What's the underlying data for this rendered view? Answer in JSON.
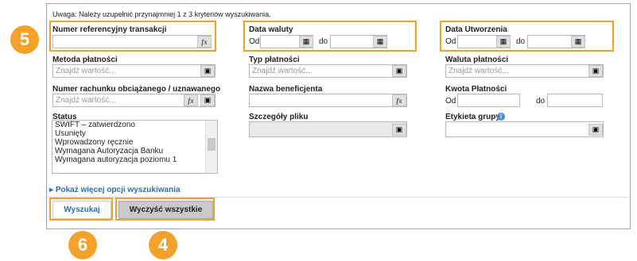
{
  "note": "Uwaga: Należy uzupełnić przynajmniej 1 z 3 kryteriów wyszukiwania.",
  "fields": {
    "numer_ref": {
      "label": "Numer referencyjny transakcji",
      "value": "",
      "fx": "fx"
    },
    "data_waluty": {
      "label": "Data waluty",
      "od": "Od",
      "do": "do"
    },
    "data_utworzenia": {
      "label": "Data Utworzenia",
      "od": "Od",
      "do": "do"
    },
    "metoda": {
      "label": "Metoda płatności",
      "placeholder": "Znajdź wartość..."
    },
    "typ": {
      "label": "Typ płatności",
      "placeholder": "Znajdź wartość..."
    },
    "waluta": {
      "label": "Waluta płatności",
      "placeholder": "Znajdź wartość..."
    },
    "rachunek": {
      "label": "Numer rachunku obciążanego / uznawanego",
      "placeholder": "Znajdź wartość...",
      "fx": "fx"
    },
    "beneficjent": {
      "label": "Nazwa beneficjenta",
      "fx": "fx"
    },
    "kwota": {
      "label": "Kwota Płatności",
      "od": "Od",
      "do": "do"
    },
    "status": {
      "label": "Status",
      "items": [
        "SWIFT – zatwierdzono",
        "Usunięty",
        "Wprowadzony ręcznie",
        "Wymagana Autoryzacja Banku",
        "Wymagana autoryzacja poziomu 1"
      ]
    },
    "szczegoly": {
      "label": "Szczegóły pliku"
    },
    "etykieta": {
      "label": "Etykieta grupy"
    }
  },
  "more_options": "Pokaż więcej opcji wyszukiwania",
  "buttons": {
    "search": "Wyszukaj",
    "clear": "Wyczyść wszystkie"
  },
  "callouts": {
    "c5": "5",
    "c6": "6",
    "c4": "4"
  },
  "colors": {
    "callout": "#f4a12a",
    "link": "#2a6eb4"
  }
}
